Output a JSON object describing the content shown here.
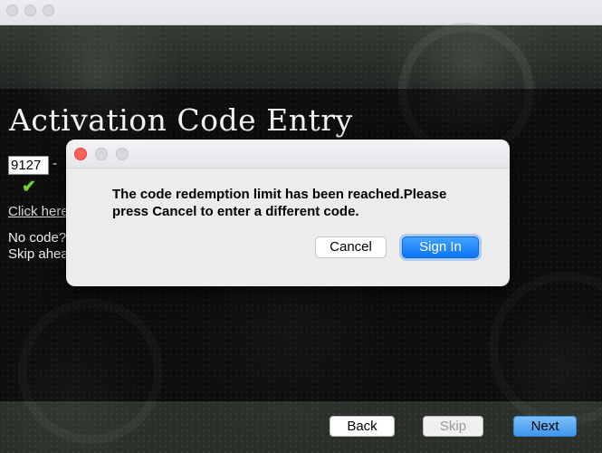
{
  "page": {
    "title": "Activation Code Entry",
    "code_value": "9127",
    "code_separator": "-",
    "checkmark": "✔",
    "click_link": "Click here",
    "no_code": "No code?",
    "skip_ahead": "Skip ahea"
  },
  "nav": {
    "back_label": "Back",
    "skip_label": "Skip",
    "next_label": "Next"
  },
  "dialog": {
    "message": "The code redemption limit has been reached.Please press Cancel to enter a different code.",
    "cancel_label": "Cancel",
    "signin_label": "Sign In"
  },
  "colors": {
    "accent": "#0a75f5",
    "close_red": "#fe5f57",
    "check_green": "#6fd12a"
  }
}
